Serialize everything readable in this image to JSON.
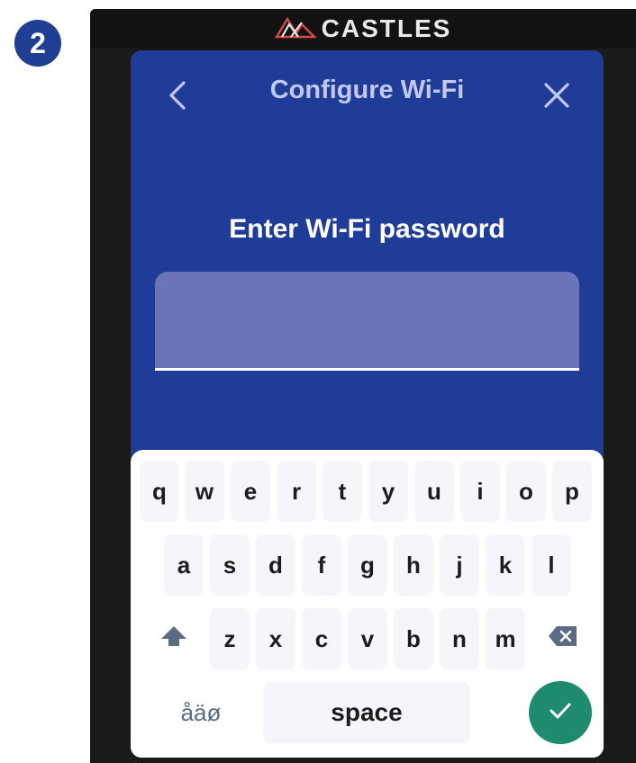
{
  "step": {
    "number": "2"
  },
  "device": {
    "brand": "CASTLES"
  },
  "header": {
    "title": "Configure Wi-Fi"
  },
  "prompt": "Enter Wi-Fi password",
  "password_field": {
    "value": "",
    "placeholder": ""
  },
  "keyboard": {
    "row1": [
      "q",
      "w",
      "e",
      "r",
      "t",
      "y",
      "u",
      "i",
      "o",
      "p"
    ],
    "row2": [
      "a",
      "s",
      "d",
      "f",
      "g",
      "h",
      "j",
      "k",
      "l"
    ],
    "row3": [
      "z",
      "x",
      "c",
      "v",
      "b",
      "n",
      "m"
    ],
    "alt_label": "åäø",
    "space_label": "space"
  },
  "icons": {
    "back": "chevron-left-icon",
    "close": "close-icon",
    "shift": "shift-arrow-icon",
    "backspace": "backspace-icon",
    "confirm": "checkmark-icon"
  },
  "colors": {
    "screen_bg": "#1f3c99",
    "input_bg": "#6b74b8",
    "accent_green": "#1e8a6e",
    "badge": "#1f3f94"
  }
}
